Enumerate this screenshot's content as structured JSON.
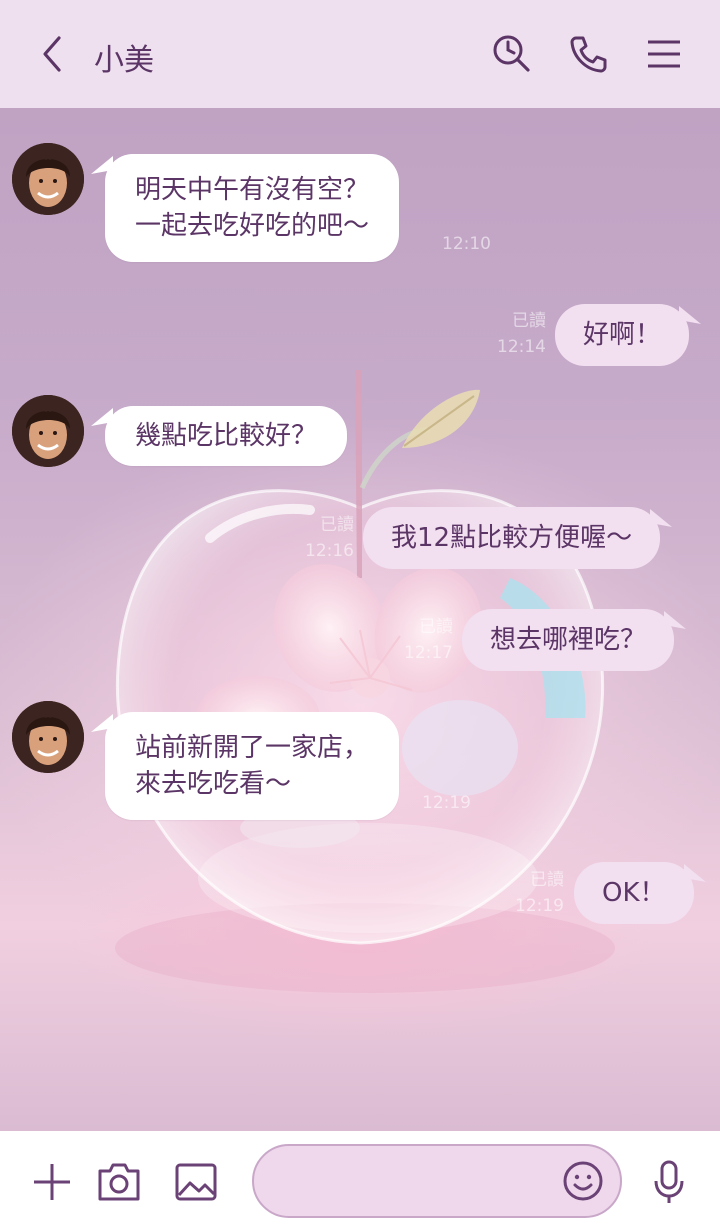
{
  "header": {
    "title": "小美",
    "back_icon": "chevron-left-icon",
    "search_icon": "clock-search-icon",
    "call_icon": "phone-icon",
    "menu_icon": "hamburger-menu-icon"
  },
  "colors": {
    "header_bg": "#efe0ef",
    "accent": "#5b3566",
    "incoming_bubble": "#ffffff",
    "outgoing_bubble": "#f2dff0",
    "input_field": "#efd8ec"
  },
  "messages": [
    {
      "direction": "in",
      "lines": [
        "明天中午有沒有空？",
        "一起去吃好吃的吧～"
      ],
      "time": "12:10"
    },
    {
      "direction": "out",
      "text": "好啊！",
      "read": "已讀",
      "time": "12:14"
    },
    {
      "direction": "in",
      "lines": [
        "幾點吃比較好？"
      ],
      "time": ""
    },
    {
      "direction": "out",
      "text": "我12點比較方便喔～",
      "read": "已讀",
      "time": "12:16"
    },
    {
      "direction": "out",
      "text": "想去哪裡吃？",
      "read": "已讀",
      "time": "12:17"
    },
    {
      "direction": "in",
      "lines": [
        "站前新開了一家店，",
        "來去吃吃看～"
      ],
      "time": "12:19"
    },
    {
      "direction": "out",
      "text": "OK！",
      "read": "已讀",
      "time": "12:19"
    }
  ],
  "input": {
    "value": "",
    "placeholder": "",
    "plus_icon": "plus-icon",
    "camera_icon": "camera-icon",
    "image_icon": "image-icon",
    "emoji_icon": "smiley-icon",
    "mic_icon": "microphone-icon"
  }
}
